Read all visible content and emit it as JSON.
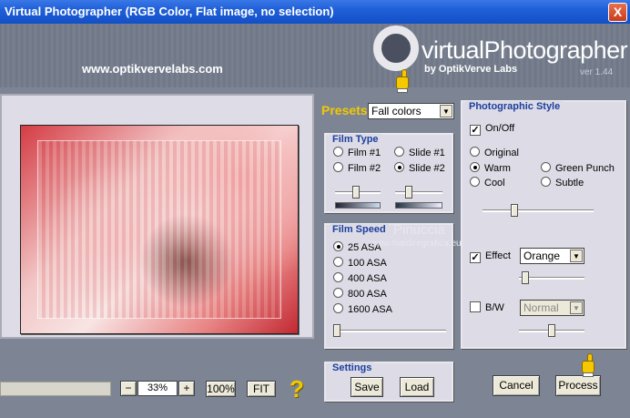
{
  "window": {
    "title": "Virtual Photographer (RGB Color, Flat image, no selection)",
    "close_glyph": "X"
  },
  "header": {
    "url": "www.optikvervelabs.com",
    "logo_title": "virtualPhotographer",
    "logo_sub": "by OptikVerve Labs",
    "version": "ver 1.44"
  },
  "presets": {
    "label": "Presets",
    "selected": "Fall colors"
  },
  "film_type": {
    "title": "Film Type",
    "options": [
      "Film #1",
      "Film #2",
      "Slide #1",
      "Slide #2"
    ],
    "selected": "Slide #2",
    "slider_film": 0.45,
    "slider_slide": 0.25
  },
  "film_speed": {
    "title": "Film Speed",
    "options": [
      "25 ASA",
      "100 ASA",
      "400 ASA",
      "800 ASA",
      "1600 ASA"
    ],
    "selected": "25 ASA",
    "slider": 0.0
  },
  "settings": {
    "title": "Settings",
    "save_label": "Save",
    "load_label": "Load"
  },
  "photographic_style": {
    "title": "Photographic Style",
    "onoff_label": "On/Off",
    "onoff_checked": true,
    "options": [
      "Original",
      "Warm",
      "Cool",
      "Green Punch",
      "Subtle"
    ],
    "selected": "Warm",
    "slider": 0.27,
    "effect_label": "Effect",
    "effect_checked": true,
    "effect_value": "Orange",
    "effect_slider": 0.05,
    "bw_label": "B/W",
    "bw_checked": false,
    "bw_value": "Normal",
    "bw_slider": 0.5
  },
  "zoom": {
    "minus": "−",
    "value": "33%",
    "plus": "+",
    "full": "100%",
    "fit": "FIT",
    "help": "?"
  },
  "actions": {
    "cancel_label": "Cancel",
    "process_label": "Process"
  },
  "watermark": {
    "name": "Pinuccia",
    "site": "www.maidiregrafica.eu"
  },
  "colors": {
    "titlebar": "#1f5fd8",
    "group_title": "#1c3f9c",
    "accent_yellow": "#f2c800"
  }
}
